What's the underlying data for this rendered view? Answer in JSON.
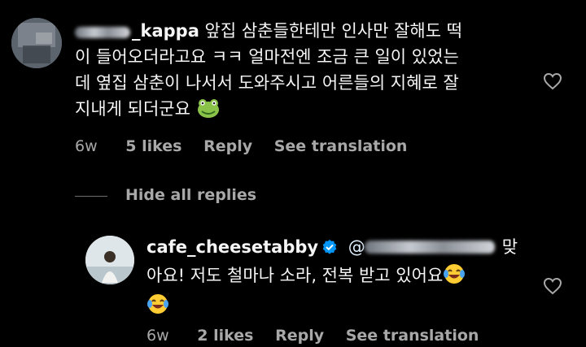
{
  "comment": {
    "username_visible": "_kappa",
    "text_line1": " 앞집 삼춘들한테만 인사만 잘해도 떡",
    "text_line2": "이 들어오더라고요 ㅋㅋ 얼마전엔 조금 큰 일이 있었는",
    "text_line3": "데 옆집 삼춘이 나서서 도와주시고 어른들의 지혜로 잘",
    "text_line4": "지내게 되더군요 ",
    "emoji": "frog",
    "age": "6w",
    "likes": "5 likes",
    "reply_label": "Reply",
    "translate_label": "See translation"
  },
  "thread": {
    "hide_replies_label": "Hide all replies"
  },
  "reply": {
    "username": "cafe_cheesetabby",
    "verified": true,
    "mention_prefix": "@",
    "text_line1_end": "맞",
    "text_line2": "아요! 저도 철마나 소라, 전복 받고 있어요",
    "emoji": "face-with-tears-of-joy",
    "age": "6w",
    "likes": "2 likes",
    "reply_label": "Reply",
    "translate_label": "See translation"
  },
  "colors": {
    "background": "#000000",
    "text": "#f5f5f5",
    "meta": "#a8a8a8",
    "verified": "#0095f6"
  }
}
